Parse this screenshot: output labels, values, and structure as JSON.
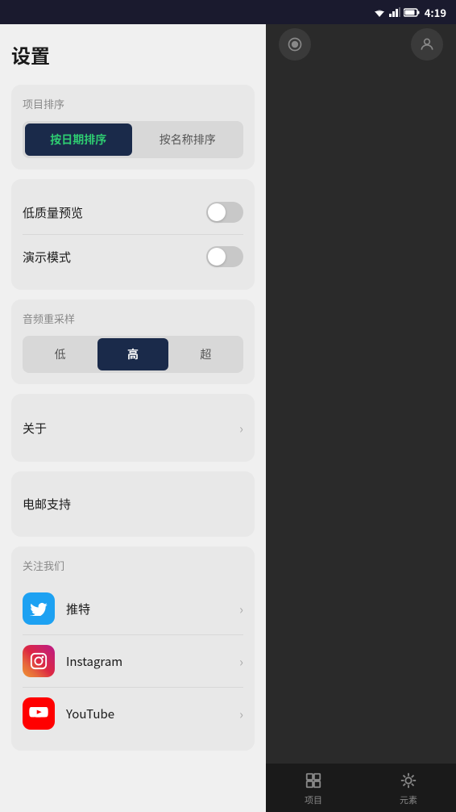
{
  "statusBar": {
    "time": "4:19"
  },
  "settings": {
    "title": "设置",
    "sortSection": {
      "label": "项目排序",
      "buttons": [
        {
          "label": "按日期排序",
          "active": true
        },
        {
          "label": "按名称排序",
          "active": false
        }
      ]
    },
    "toggles": [
      {
        "label": "低质量预览",
        "enabled": false
      },
      {
        "label": "演示模式",
        "enabled": false
      }
    ],
    "resampleSection": {
      "label": "音频重采样",
      "buttons": [
        {
          "label": "低",
          "active": false
        },
        {
          "label": "高",
          "active": true
        },
        {
          "label": "超",
          "active": false
        }
      ]
    },
    "navItems": [
      {
        "label": "关于",
        "hasChevron": true
      },
      {
        "label": "电邮支持",
        "hasChevron": false
      }
    ],
    "followSection": {
      "label": "关注我们",
      "items": [
        {
          "name": "推特",
          "iconType": "twitter"
        },
        {
          "name": "Instagram",
          "iconType": "instagram"
        },
        {
          "name": "YouTube",
          "iconType": "youtube"
        }
      ]
    }
  },
  "bottomNav": {
    "tabs": [
      {
        "label": "项目"
      },
      {
        "label": "元素"
      }
    ]
  }
}
